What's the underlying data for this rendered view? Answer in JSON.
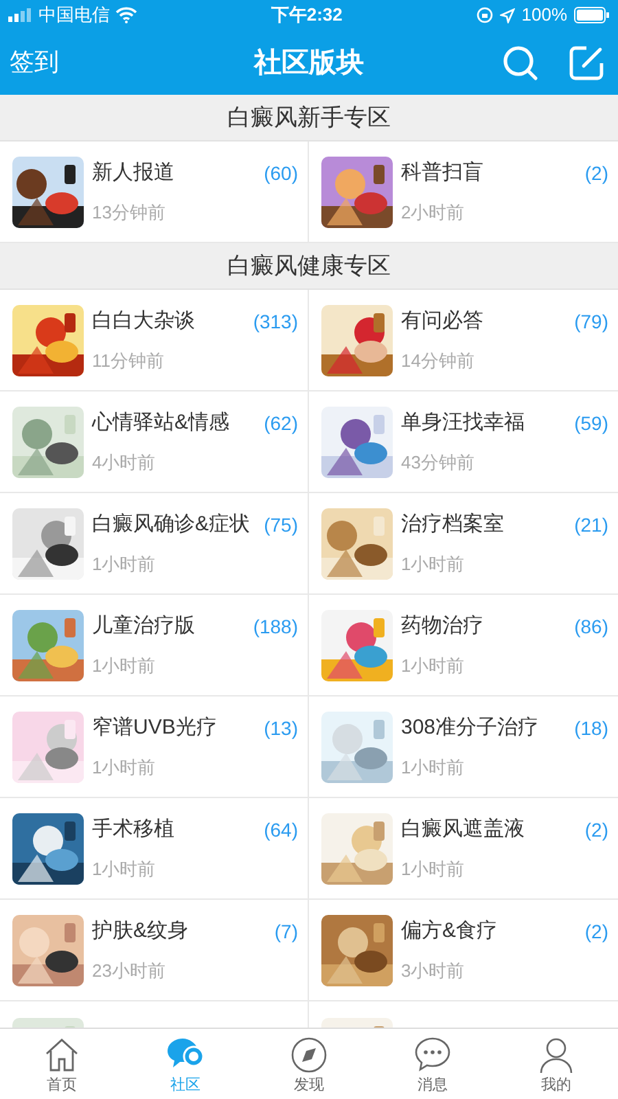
{
  "status_bar": {
    "carrier": "中国电信",
    "time": "下午2:32",
    "battery": "100%"
  },
  "nav": {
    "left": "签到",
    "title": "社区版块"
  },
  "sections": [
    {
      "title": "白癜风新手专区",
      "boards": [
        {
          "name": "新人报道",
          "count": "(60)",
          "time": "13分钟前"
        },
        {
          "name": "科普扫盲",
          "count": "(2)",
          "time": "2小时前"
        }
      ]
    },
    {
      "title": "白癜风健康专区",
      "boards": [
        {
          "name": "白白大杂谈",
          "count": "(313)",
          "time": "11分钟前"
        },
        {
          "name": "有问必答",
          "count": "(79)",
          "time": "14分钟前"
        },
        {
          "name": "心情驿站&情感",
          "count": "(62)",
          "time": "4小时前"
        },
        {
          "name": "单身汪找幸福",
          "count": "(59)",
          "time": "43分钟前"
        },
        {
          "name": "白癜风确诊&症状",
          "count": "(75)",
          "time": "1小时前"
        },
        {
          "name": "治疗档案室",
          "count": "(21)",
          "time": "1小时前"
        },
        {
          "name": "儿童治疗版",
          "count": "(188)",
          "time": "1小时前"
        },
        {
          "name": "药物治疗",
          "count": "(86)",
          "time": "1小时前"
        },
        {
          "name": "窄谱UVB光疗",
          "count": "(13)",
          "time": "1小时前"
        },
        {
          "name": "308准分子治疗",
          "count": "(18)",
          "time": "1小时前"
        },
        {
          "name": "手术移植",
          "count": "(64)",
          "time": "1小时前"
        },
        {
          "name": "白癜风遮盖液",
          "count": "(2)",
          "time": "1小时前"
        },
        {
          "name": "护肤&纹身",
          "count": "(7)",
          "time": "23小时前"
        },
        {
          "name": "偏方&食疗",
          "count": "(2)",
          "time": "3小时前"
        }
      ]
    }
  ],
  "tabs": [
    {
      "label": "首页",
      "kind": "home",
      "selected": false
    },
    {
      "label": "社区",
      "kind": "community",
      "selected": true
    },
    {
      "label": "发现",
      "kind": "discover",
      "selected": false
    },
    {
      "label": "消息",
      "kind": "messages",
      "selected": false
    },
    {
      "label": "我的",
      "kind": "profile",
      "selected": false
    }
  ]
}
